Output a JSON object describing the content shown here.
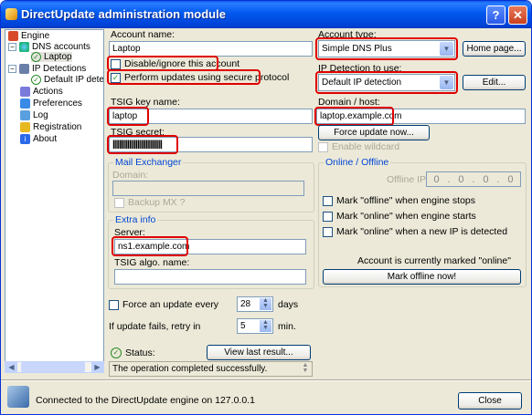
{
  "window": {
    "title": "DirectUpdate administration module",
    "help": "?",
    "close": "✕"
  },
  "tree": {
    "engine": "Engine",
    "dns_accounts": "DNS accounts",
    "laptop": "Laptop",
    "ip_detections": "IP Detections",
    "default_ip": "Default IP dete",
    "actions": "Actions",
    "preferences": "Preferences",
    "log": "Log",
    "registration": "Registration",
    "about": "About"
  },
  "account": {
    "name_label": "Account name:",
    "name_value": "Laptop",
    "disable_label": "Disable/ignore this account",
    "secure_label": "Perform updates using secure protocol",
    "type_label": "Account type:",
    "type_value": "Simple DNS Plus",
    "homepage_button": "Home page...",
    "ipdet_label": "IP Detection to use:",
    "ipdet_value": "Default IP detection",
    "edit_button": "Edit...",
    "tsig_name_label": "TSIG key name:",
    "tsig_name_value": "laptop",
    "tsig_secret_label": "TSIG secret:",
    "tsig_secret_value": "||||||||||||||||||||||||||||||",
    "domain_label": "Domain / host:",
    "domain_value": "laptop.example.com",
    "force_button": "Force update now...",
    "wildcard_label": "Enable wildcard"
  },
  "mail": {
    "group": "Mail Exchanger",
    "domain_label": "Domain:",
    "backup_label": "Backup MX ?"
  },
  "extra": {
    "group": "Extra info",
    "server_label": "Server:",
    "server_value": "ns1.example.com",
    "algo_label": "TSIG algo. name:"
  },
  "online": {
    "group": "Online / Offline",
    "offline_ip_label": "Offline IP",
    "offline_ip": [
      "0",
      "0",
      "0",
      "0"
    ],
    "mark_offline_stop": "Mark \"offline\" when engine stops",
    "mark_online_start": "Mark \"online\" when engine starts",
    "mark_online_newip": "Mark \"online\" when a new IP is detected",
    "current_mark": "Account is currently marked \"online\"",
    "mark_offline_button": "Mark offline now!"
  },
  "schedule": {
    "force_label": "Force an update every",
    "force_value": "28",
    "force_unit": "days",
    "retry_label": "If update fails, retry in",
    "retry_value": "5",
    "retry_unit": "min."
  },
  "status": {
    "label": "Status:",
    "view_button": "View last result...",
    "text": "The operation completed successfully."
  },
  "footer": {
    "connected": "Connected to the DirectUpdate engine on 127.0.0.1",
    "close_button": "Close"
  }
}
